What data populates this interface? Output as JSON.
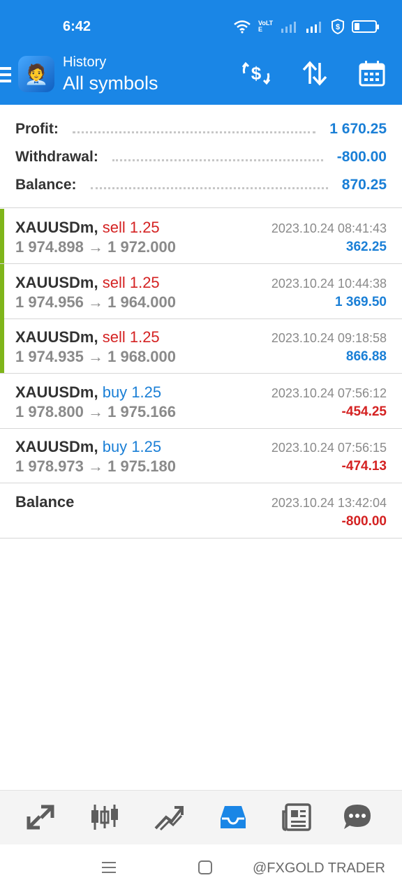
{
  "status_bar": {
    "time": "6:42",
    "network": "VoLTE"
  },
  "header": {
    "title": "History",
    "subtitle": "All symbols"
  },
  "summary": [
    {
      "label": "Profit:",
      "value": "1 670.25"
    },
    {
      "label": "Withdrawal:",
      "value": "-800.00"
    },
    {
      "label": "Balance:",
      "value": "870.25"
    }
  ],
  "deals": [
    {
      "symbol": "XAUUSDm,",
      "side": "sell",
      "volume": "1.25",
      "open": "1 974.898",
      "arrow": "→",
      "close": "1 972.000",
      "time": "2023.10.24 08:41:43",
      "profit": "362.25",
      "sign": "pos",
      "marker": true
    },
    {
      "symbol": "XAUUSDm,",
      "side": "sell",
      "volume": "1.25",
      "open": "1 974.956",
      "arrow": "→",
      "close": "1 964.000",
      "time": "2023.10.24 10:44:38",
      "profit": "1 369.50",
      "sign": "pos",
      "marker": true
    },
    {
      "symbol": "XAUUSDm,",
      "side": "sell",
      "volume": "1.25",
      "open": "1 974.935",
      "arrow": "→",
      "close": "1 968.000",
      "time": "2023.10.24 09:18:58",
      "profit": "866.88",
      "sign": "pos",
      "marker": true
    },
    {
      "symbol": "XAUUSDm,",
      "side": "buy",
      "volume": "1.25",
      "open": "1 978.800",
      "arrow": "→",
      "close": "1 975.166",
      "time": "2023.10.24 07:56:12",
      "profit": "-454.25",
      "sign": "neg",
      "marker": false
    },
    {
      "symbol": "XAUUSDm,",
      "side": "buy",
      "volume": "1.25",
      "open": "1 978.973",
      "arrow": "→",
      "close": "1 975.180",
      "time": "2023.10.24 07:56:15",
      "profit": "-474.13",
      "sign": "neg",
      "marker": false
    }
  ],
  "balance_row": {
    "label": "Balance",
    "time": "2023.10.24 13:42:04",
    "profit": "-800.00"
  },
  "tabs": [
    "quotes-icon",
    "chart-icon",
    "trade-icon",
    "history-icon",
    "news-icon",
    "messages-icon"
  ],
  "watermark": "@FXGOLD TRADER",
  "colors": {
    "header": "#1a86e6",
    "profit": "#1a7fd6",
    "loss": "#d42222",
    "marker": "#7fb51a"
  }
}
